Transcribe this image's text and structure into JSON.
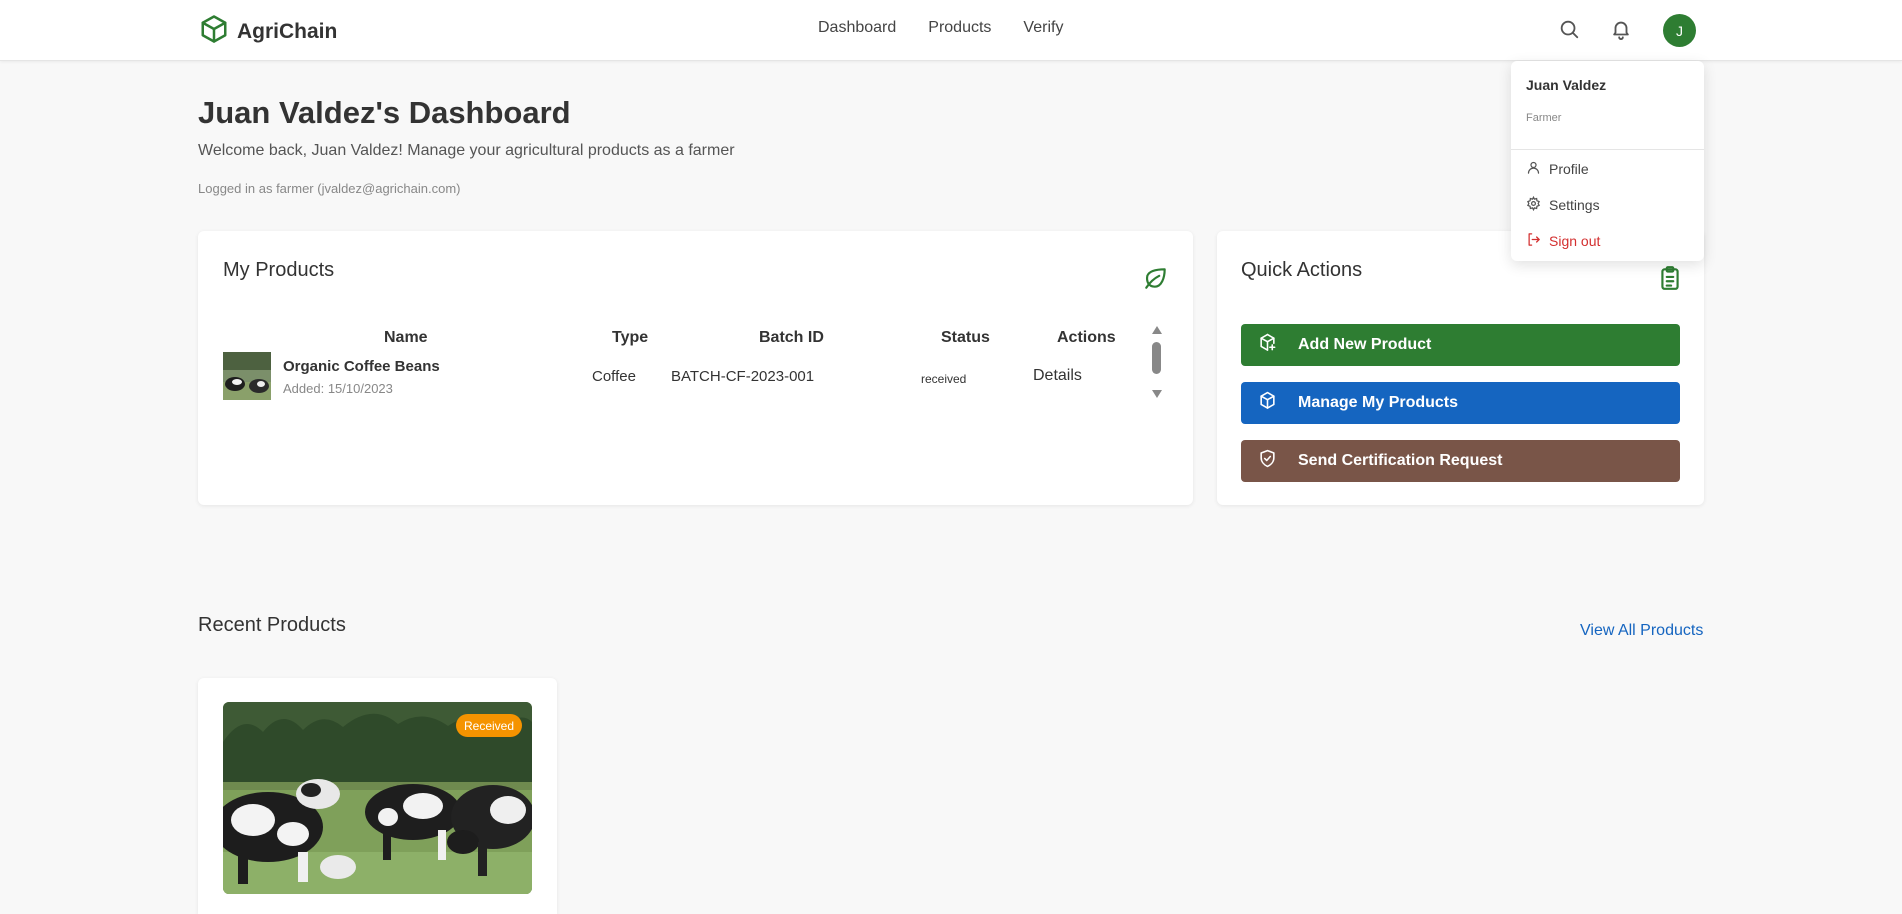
{
  "header": {
    "brand": "AgriChain",
    "nav": [
      "Dashboard",
      "Products",
      "Verify"
    ],
    "avatar_initial": "J",
    "icons": {
      "logo": "cube-icon",
      "search": "search-icon",
      "notifications": "bell-icon"
    }
  },
  "user_menu": {
    "name": "Juan Valdez",
    "role": "Farmer",
    "items": [
      {
        "label": "Profile",
        "icon": "user-icon"
      },
      {
        "label": "Settings",
        "icon": "gear-icon"
      },
      {
        "label": "Sign out",
        "icon": "sign-out-icon"
      }
    ]
  },
  "page": {
    "title": "Juan Valdez's Dashboard",
    "welcome": "Welcome back, Juan Valdez! Manage your agricultural products as a farmer",
    "logged_in": "Logged in as farmer (jvaldez@agrichain.com)"
  },
  "my_products": {
    "title": "My Products",
    "columns": [
      "Name",
      "Type",
      "Batch ID",
      "Status",
      "Actions"
    ],
    "rows": [
      {
        "name": "Organic Coffee Beans",
        "added": "Added: 15/10/2023",
        "type": "Coffee",
        "batch_id": "BATCH-CF-2023-001",
        "status": "received",
        "action": "Details"
      }
    ]
  },
  "quick_actions": {
    "title": "Quick Actions",
    "buttons": [
      {
        "label": "Add New Product",
        "color": "#2e7d32",
        "icon": "package-plus-icon"
      },
      {
        "label": "Manage My Products",
        "color": "#1565c0",
        "icon": "package-icon"
      },
      {
        "label": "Send Certification Request",
        "color": "#795548",
        "icon": "shield-check-icon"
      }
    ]
  },
  "recent_products": {
    "title": "Recent Products",
    "view_all": "View All Products",
    "badge": "Received"
  },
  "colors": {
    "brand_green": "#2e7d32",
    "link_blue": "#1565c0",
    "badge_orange": "#f59300",
    "danger_red": "#d32f2f"
  }
}
